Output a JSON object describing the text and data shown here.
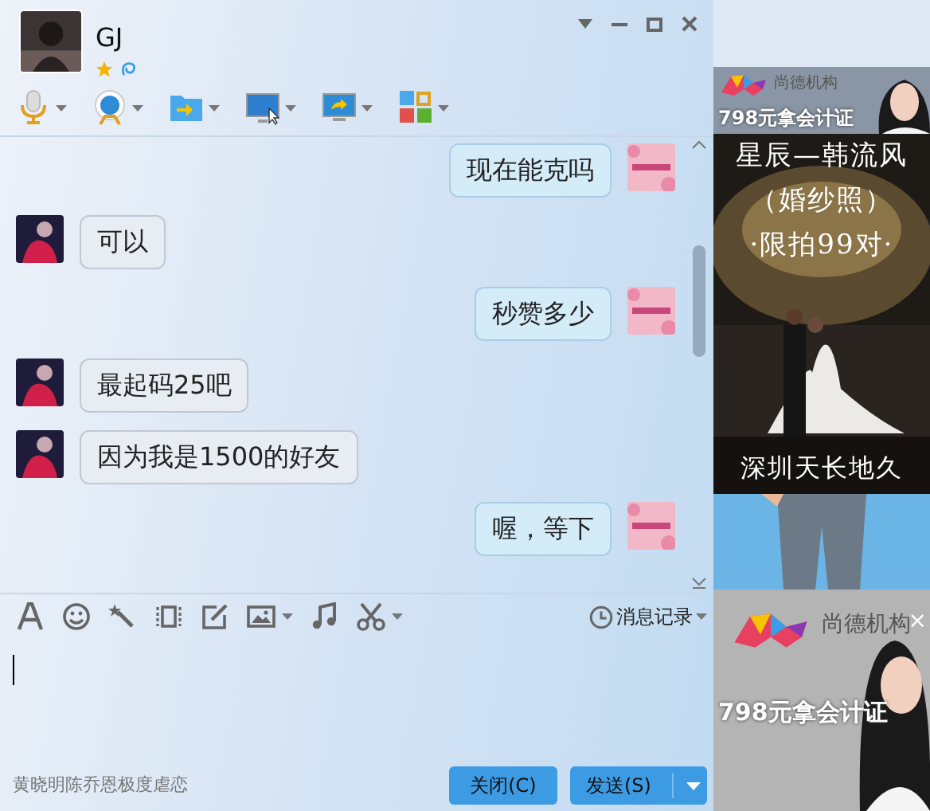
{
  "contact": {
    "name": "GJ"
  },
  "messages": [
    {
      "kind": "sent",
      "text": "现在能克吗"
    },
    {
      "kind": "received",
      "text": "可以"
    },
    {
      "kind": "sent",
      "text": "秒赞多少"
    },
    {
      "kind": "received",
      "text": "最起码25吧"
    },
    {
      "kind": "received",
      "text": "因为我是1500的好友"
    },
    {
      "kind": "sent",
      "text": "喔，等下"
    }
  ],
  "input_toolbar": {
    "history_label": "消息记录"
  },
  "footer": {
    "text": "黄晓明陈乔恩极度虐恋"
  },
  "buttons": [
    {
      "kind": "close",
      "label": "关闭(C)"
    },
    {
      "kind": "send",
      "label": "发送(S)"
    }
  ],
  "ads": [
    {
      "kind": "brand",
      "brand": "尚德机构",
      "text": "798元拿会计证"
    },
    {
      "kind": "wedding",
      "lines": [
        "星辰—韩流风",
        "（婚纱照）",
        "·限拍99对·",
        "深圳天长地久"
      ]
    },
    {
      "kind": "picture"
    },
    {
      "kind": "brand",
      "brand": "尚德机构",
      "text": "798元拿会计证",
      "close": "×"
    }
  ]
}
